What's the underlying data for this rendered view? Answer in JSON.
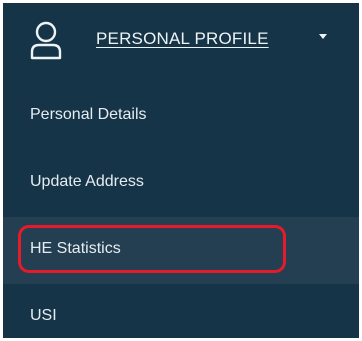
{
  "header": {
    "title": "PERSONAL PROFILE",
    "user_icon": "user-icon",
    "dropdown_icon": "caret-down-icon"
  },
  "menu": {
    "items": [
      {
        "label": "Personal Details",
        "active": false
      },
      {
        "label": "Update Address",
        "active": false
      },
      {
        "label": "HE Statistics",
        "active": true
      },
      {
        "label": "USI",
        "active": false
      }
    ]
  },
  "colors": {
    "sidebar_bg": "#163447",
    "active_bg": "#243f52",
    "text": "#e6edf1",
    "highlight": "#e31b2b"
  }
}
